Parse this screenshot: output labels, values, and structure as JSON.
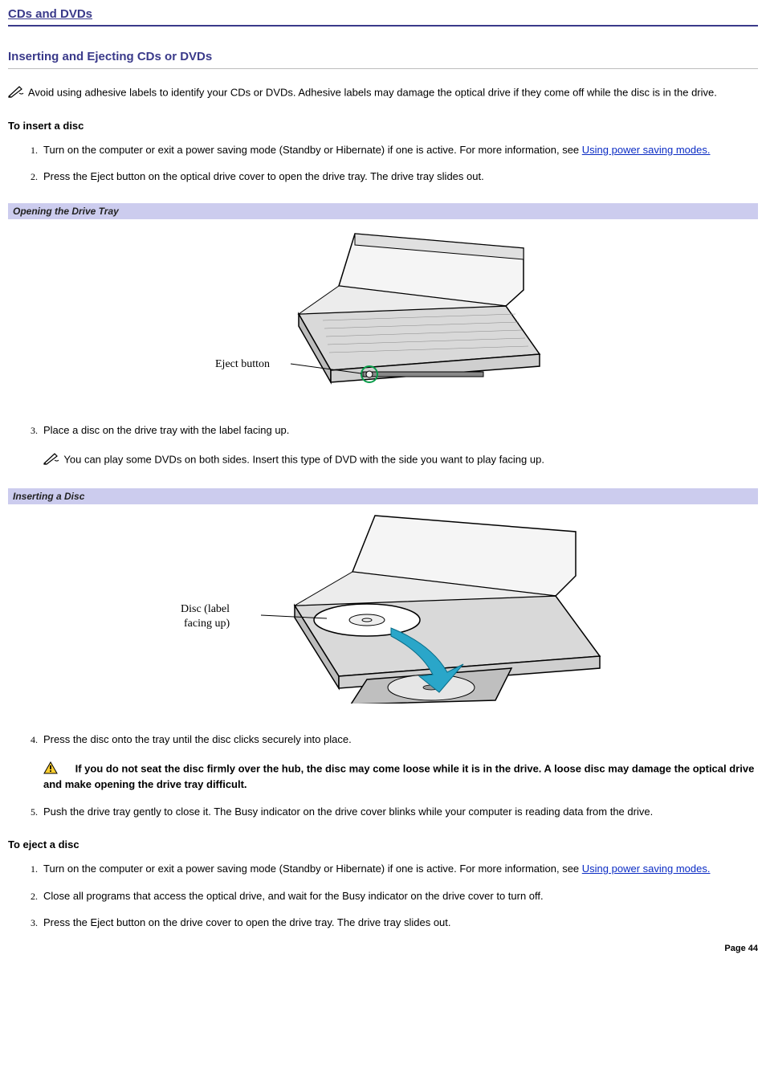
{
  "topicTitle": "CDs and DVDs",
  "sectionTitle": "Inserting and Ejecting CDs or DVDs",
  "topNote": "Avoid using adhesive labels to identify your CDs or DVDs. Adhesive labels may damage the optical drive if they come off while the disc is in the drive.",
  "insert": {
    "heading": "To insert a disc",
    "step1_pre": "Turn on the computer or exit a power saving mode (Standby or Hibernate) if one is active. For more information, see ",
    "step1_link": "Using power saving modes.",
    "step2": "Press the Eject button on the optical drive cover to open the drive tray. The drive tray slides out.",
    "caption1": "Opening the Drive Tray",
    "fig1_label": "Eject button",
    "step3": "Place a disc on the drive tray with the label facing up.",
    "step3_note": "You can play some DVDs on both sides. Insert this type of DVD with the side you want to play facing up.",
    "caption2": "Inserting a Disc",
    "fig2_label1": "Disc (label",
    "fig2_label2": "facing up)",
    "step4": "Press the disc onto the tray until the disc clicks securely into place.",
    "step4_warn": "If you do not seat the disc firmly over the hub, the disc may come loose while it is in the drive. A loose disc may damage the optical drive and make opening the drive tray difficult.",
    "step5": "Push the drive tray gently to close it. The Busy indicator on the drive cover blinks while your computer is reading data from the drive."
  },
  "eject": {
    "heading": "To eject a disc",
    "step1_pre": "Turn on the computer or exit a power saving mode (Standby or Hibernate) if one is active. For more information, see ",
    "step1_link": "Using power saving modes.",
    "step2": "Close all programs that access the optical drive, and wait for the Busy indicator on the drive cover to turn off.",
    "step3": "Press the Eject button on the drive cover to open the drive tray. The drive tray slides out."
  },
  "pageNum": "Page 44"
}
